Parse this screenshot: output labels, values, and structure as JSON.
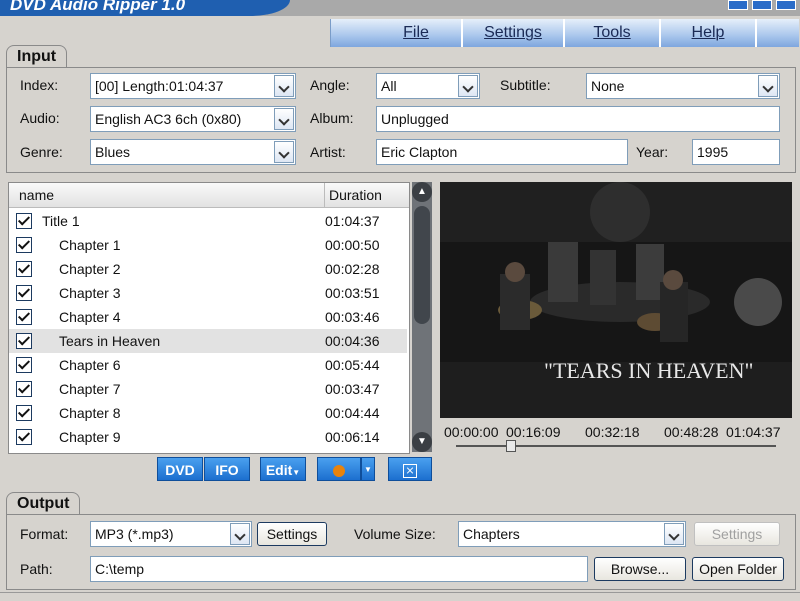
{
  "app": {
    "title": "DVD Audio Ripper 1.0"
  },
  "menu": [
    {
      "label": "File"
    },
    {
      "label": "Settings"
    },
    {
      "label": "Tools"
    },
    {
      "label": "Help"
    }
  ],
  "input": {
    "group_label": "Input",
    "index": {
      "label": "Index:",
      "value": "[00] Length:01:04:37"
    },
    "angle": {
      "label": "Angle:",
      "value": "All"
    },
    "subtitle": {
      "label": "Subtitle:",
      "value": "None"
    },
    "audio": {
      "label": "Audio:",
      "value": "English AC3 6ch (0x80)"
    },
    "album": {
      "label": "Album:",
      "value": "Unplugged"
    },
    "genre": {
      "label": "Genre:",
      "value": "Blues"
    },
    "artist": {
      "label": "Artist:",
      "value": "Eric Clapton"
    },
    "year": {
      "label": "Year:",
      "value": "1995"
    }
  },
  "list": {
    "columns": {
      "name": "name",
      "duration": "Duration"
    },
    "rows": [
      {
        "name": "Title 1",
        "duration": "01:04:37",
        "checked": true
      },
      {
        "name": "Chapter 1",
        "duration": "00:00:50",
        "checked": true
      },
      {
        "name": "Chapter 2",
        "duration": "00:02:28",
        "checked": true
      },
      {
        "name": "Chapter 3",
        "duration": "00:03:51",
        "checked": true
      },
      {
        "name": "Chapter 4",
        "duration": "00:03:46",
        "checked": true
      },
      {
        "name": "Tears in Heaven",
        "duration": "00:04:36",
        "checked": true,
        "selected": true
      },
      {
        "name": "Chapter 6",
        "duration": "00:05:44",
        "checked": true
      },
      {
        "name": "Chapter 7",
        "duration": "00:03:47",
        "checked": true
      },
      {
        "name": "Chapter 8",
        "duration": "00:04:44",
        "checked": true
      },
      {
        "name": "Chapter 9",
        "duration": "00:06:14",
        "checked": true
      }
    ]
  },
  "video": {
    "caption": "\"TEARS IN HEAVEN\""
  },
  "timeline": {
    "marks": [
      "00:00:00",
      "00:16:09",
      "00:32:18",
      "00:48:28",
      "01:04:37"
    ]
  },
  "toolbar": {
    "dvd_label": "DVD",
    "ifo_label": "IFO",
    "edit_label": "Edit",
    "stop_label": "",
    "close_label": ""
  },
  "output": {
    "group_label": "Output",
    "format": {
      "label": "Format:",
      "value": "MP3 (*.mp3)"
    },
    "settings_label": "Settings",
    "volume_size": {
      "label": "Volume Size:",
      "value": "Chapters"
    },
    "settings2_label": "Settings",
    "path": {
      "label": "Path:",
      "value": "C:\\temp"
    },
    "browse_label": "Browse...",
    "open_folder_label": "Open Folder"
  },
  "colors": {
    "accent": "#1f5fb0",
    "toolbar_blue": "#2d86e3",
    "record_orange": "#e8830c"
  }
}
